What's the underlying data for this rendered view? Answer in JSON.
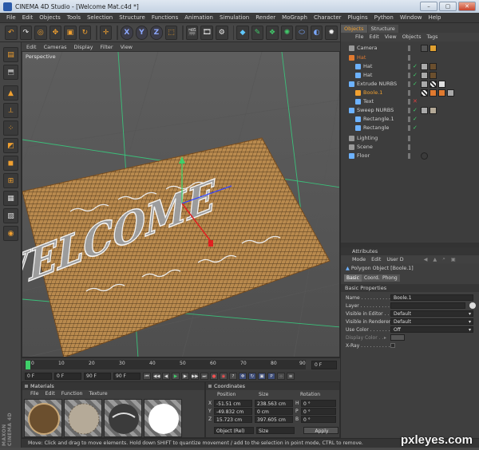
{
  "window": {
    "title": "CINEMA 4D Studio - [Welcome Mat.c4d *]",
    "min": "–",
    "max": "▢",
    "close": "✕"
  },
  "menubar": [
    "File",
    "Edit",
    "Objects",
    "Tools",
    "Selection",
    "Structure",
    "Functions",
    "Animation",
    "Simulation",
    "Render",
    "MoGraph",
    "Character",
    "Plugins",
    "Python",
    "Window",
    "Help"
  ],
  "toolbar": {
    "x": "X",
    "y": "Y",
    "z": "Z"
  },
  "viewport": {
    "menu": [
      "Edit",
      "Cameras",
      "Display",
      "Filter",
      "View"
    ],
    "label": "Perspective",
    "mat_text": "WELCOME"
  },
  "timeline": {
    "ticks": [
      "0",
      "10",
      "20",
      "30",
      "40",
      "50",
      "60",
      "70",
      "80",
      "90"
    ],
    "current_frame": "0 F"
  },
  "transport": {
    "start": "0 F",
    "field2": "0 F",
    "end": "90 F",
    "field4": "90 F"
  },
  "materials": {
    "title": "Materials",
    "menu": [
      "File",
      "Edit",
      "Function",
      "Texture"
    ]
  },
  "coordinates": {
    "title": "Coordinates",
    "headers": [
      "Position",
      "Size",
      "Rotation"
    ],
    "rows": [
      {
        "axis": "X",
        "pos": "-51.51 cm",
        "size": "238.563 cm",
        "rot_label": "H",
        "rot": "0 °"
      },
      {
        "axis": "Y",
        "pos": "-49.832 cm",
        "size": "0 cm",
        "rot_label": "P",
        "rot": "0 °"
      },
      {
        "axis": "Z",
        "pos": "15.723 cm",
        "size": "397.605 cm",
        "rot_label": "B",
        "rot": "0 °"
      }
    ],
    "mode": "Object (Rel)",
    "size_mode": "Size",
    "apply": "Apply"
  },
  "status": "Move: Click and drag to move elements. Hold down SHIFT to quantize movement / add to the selection in point mode, CTRL to remove.",
  "object_manager": {
    "tabs": [
      "Objects",
      "Structure"
    ],
    "menu": [
      "File",
      "Edit",
      "View",
      "Objects",
      "Tags"
    ],
    "items": [
      {
        "name": "Camera",
        "indent": 0,
        "color": "#9a9a9a"
      },
      {
        "name": "Hat",
        "indent": 0,
        "color": "#e07a30"
      },
      {
        "name": "Hat",
        "indent": 1,
        "color": "#6db2ff"
      },
      {
        "name": "Hat",
        "indent": 1,
        "color": "#6db2ff"
      },
      {
        "name": "Extrude NURBS",
        "indent": 0,
        "color": "#6db2ff"
      },
      {
        "name": "Boole.1",
        "indent": 1,
        "color": "#f0a030"
      },
      {
        "name": "Text",
        "indent": 1,
        "color": "#6db2ff"
      },
      {
        "name": "Sweep NURBS",
        "indent": 0,
        "color": "#6db2ff"
      },
      {
        "name": "Rectangle.1",
        "indent": 1,
        "color": "#6db2ff"
      },
      {
        "name": "Rectangle",
        "indent": 1,
        "color": "#6db2ff"
      },
      {
        "name": "Lighting",
        "indent": 0,
        "color": "#9a9a9a"
      },
      {
        "name": "Scene",
        "indent": 0,
        "color": "#9a9a9a"
      },
      {
        "name": "Floor",
        "indent": 0,
        "color": "#6db2ff"
      }
    ]
  },
  "attributes": {
    "title": "Attributes",
    "menu": [
      "Mode",
      "Edit",
      "User D"
    ],
    "object": "Polygon Object [Boole.1]",
    "tabs": [
      "Basic",
      "Coord.",
      "Phong"
    ],
    "section": "Basic Properties",
    "fields": [
      {
        "label": "Name . . . . . . . . . . . .",
        "value": "Boole.1"
      },
      {
        "label": "Layer . . . . . . . . . . . .",
        "value": ""
      },
      {
        "label": "Visible in Editor . . .",
        "value": "Default"
      },
      {
        "label": "Visible in Renderer",
        "value": "Default"
      },
      {
        "label": "Use Color . . . . . . . .",
        "value": "Off"
      },
      {
        "label": "Display Color . .",
        "value": ""
      },
      {
        "label": "X-Ray . . . . . . . . . .",
        "value": ""
      }
    ]
  },
  "watermark": "pxleyes.com",
  "branding": "MAXON CINEMA 4D"
}
